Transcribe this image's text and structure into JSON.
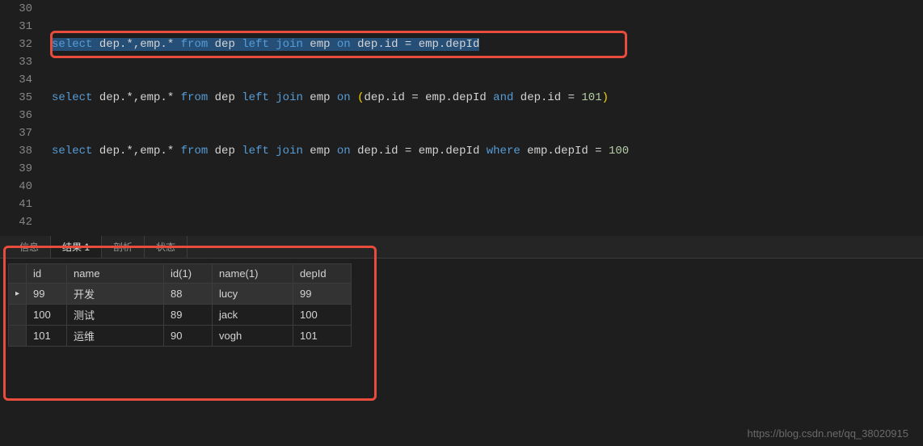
{
  "editor": {
    "lines": [
      {
        "num": "30",
        "tokens": []
      },
      {
        "num": "31",
        "tokens": []
      },
      {
        "num": "32",
        "selected": true,
        "tokens": [
          {
            "t": "select",
            "c": "kw"
          },
          {
            "t": " dep.*,emp.* ",
            "c": "txt"
          },
          {
            "t": "from",
            "c": "kw"
          },
          {
            "t": " dep ",
            "c": "txt"
          },
          {
            "t": "left",
            "c": "kw"
          },
          {
            "t": " ",
            "c": "txt"
          },
          {
            "t": "join",
            "c": "kw"
          },
          {
            "t": " emp ",
            "c": "txt"
          },
          {
            "t": "on",
            "c": "kw"
          },
          {
            "t": " dep.id = emp.depId",
            "c": "txt"
          }
        ]
      },
      {
        "num": "33",
        "tokens": []
      },
      {
        "num": "34",
        "tokens": []
      },
      {
        "num": "35",
        "tokens": [
          {
            "t": "select",
            "c": "kw"
          },
          {
            "t": " dep.*,emp.* ",
            "c": "txt"
          },
          {
            "t": "from",
            "c": "kw"
          },
          {
            "t": " dep ",
            "c": "txt"
          },
          {
            "t": "left",
            "c": "kw"
          },
          {
            "t": " ",
            "c": "txt"
          },
          {
            "t": "join",
            "c": "kw"
          },
          {
            "t": " emp ",
            "c": "txt"
          },
          {
            "t": "on",
            "c": "kw"
          },
          {
            "t": " ",
            "c": "txt"
          },
          {
            "t": "(",
            "c": "paren"
          },
          {
            "t": "dep.id = emp.depId ",
            "c": "txt"
          },
          {
            "t": "and",
            "c": "kw"
          },
          {
            "t": " dep.id = ",
            "c": "txt"
          },
          {
            "t": "101",
            "c": "num"
          },
          {
            "t": ")",
            "c": "paren"
          }
        ]
      },
      {
        "num": "36",
        "tokens": []
      },
      {
        "num": "37",
        "tokens": []
      },
      {
        "num": "38",
        "tokens": [
          {
            "t": "select",
            "c": "kw"
          },
          {
            "t": " dep.*,emp.* ",
            "c": "txt"
          },
          {
            "t": "from",
            "c": "kw"
          },
          {
            "t": " dep ",
            "c": "txt"
          },
          {
            "t": "left",
            "c": "kw"
          },
          {
            "t": " ",
            "c": "txt"
          },
          {
            "t": "join",
            "c": "kw"
          },
          {
            "t": " emp ",
            "c": "txt"
          },
          {
            "t": "on",
            "c": "kw"
          },
          {
            "t": " dep.id = emp.depId ",
            "c": "txt"
          },
          {
            "t": "where",
            "c": "kw"
          },
          {
            "t": " emp.depId = ",
            "c": "txt"
          },
          {
            "t": "100",
            "c": "num"
          }
        ]
      },
      {
        "num": "39",
        "tokens": []
      },
      {
        "num": "40",
        "tokens": []
      },
      {
        "num": "41",
        "tokens": []
      },
      {
        "num": "42",
        "tokens": [],
        "cut": true
      }
    ]
  },
  "tabs": {
    "items": [
      {
        "label": "信息",
        "active": false
      },
      {
        "label": "结果 1",
        "active": true
      },
      {
        "label": "剖析",
        "active": false
      },
      {
        "label": "状态",
        "active": false
      }
    ]
  },
  "results": {
    "headers": [
      "id",
      "name",
      "id(1)",
      "name(1)",
      "depId"
    ],
    "rows": [
      {
        "selected": true,
        "cells": [
          "99",
          "开发",
          "88",
          "lucy",
          "99"
        ]
      },
      {
        "selected": false,
        "cells": [
          "100",
          "测试",
          "89",
          "jack",
          "100"
        ]
      },
      {
        "selected": false,
        "cells": [
          "101",
          "运维",
          "90",
          "vogh",
          "101"
        ]
      }
    ]
  },
  "watermark": "https://blog.csdn.net/qq_38020915"
}
